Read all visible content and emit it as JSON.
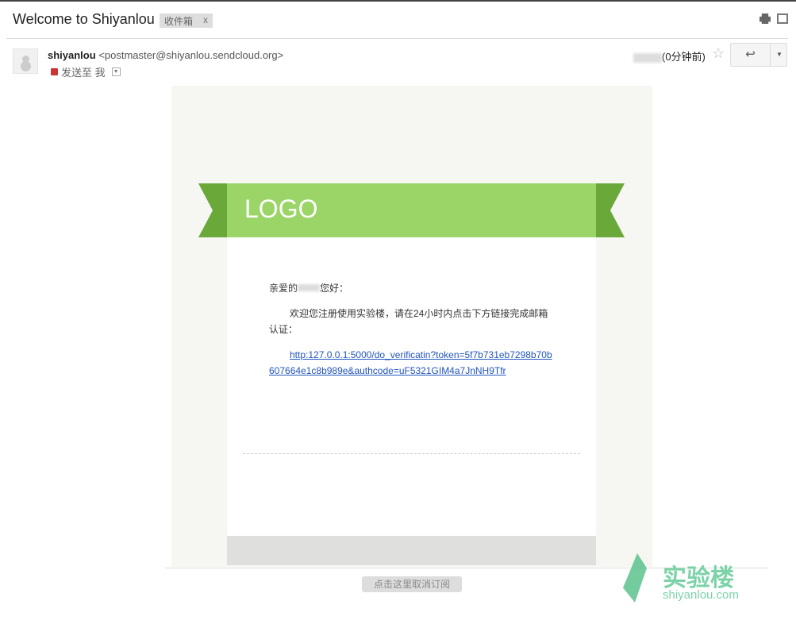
{
  "header": {
    "subject": "Welcome to Shiyanlou",
    "label": "收件箱",
    "label_close": "x"
  },
  "message": {
    "sender_name": "shiyanlou",
    "sender_email": "<postmaster@shiyanlou.sendcloud.org>",
    "to_label": "发送至 我",
    "time": "(0分钟前)",
    "reply_icon": "reply-arrow-icon",
    "more_icon": "caret-down-icon"
  },
  "email": {
    "logo": "LOGO",
    "greeting_prefix": "亲爱的",
    "greeting_suffix": "您好：",
    "body": "欢迎您注册使用实验楼，请在24小时内点击下方链接完成邮箱认证：",
    "link": "http:127.0.0.1:5000/do_verificatin?token=5f7b731eb7298b70b607664e1c8b989e&authcode=uF5321GIM4a7JnNH9Tfr",
    "unsubscribe": "点击这里取消订阅"
  },
  "watermark": {
    "cn": "实验楼",
    "en": "shiyanlou.com"
  },
  "colors": {
    "banner": "#9cd567",
    "ribbon": "#6aa83a",
    "link": "#2255bb"
  }
}
